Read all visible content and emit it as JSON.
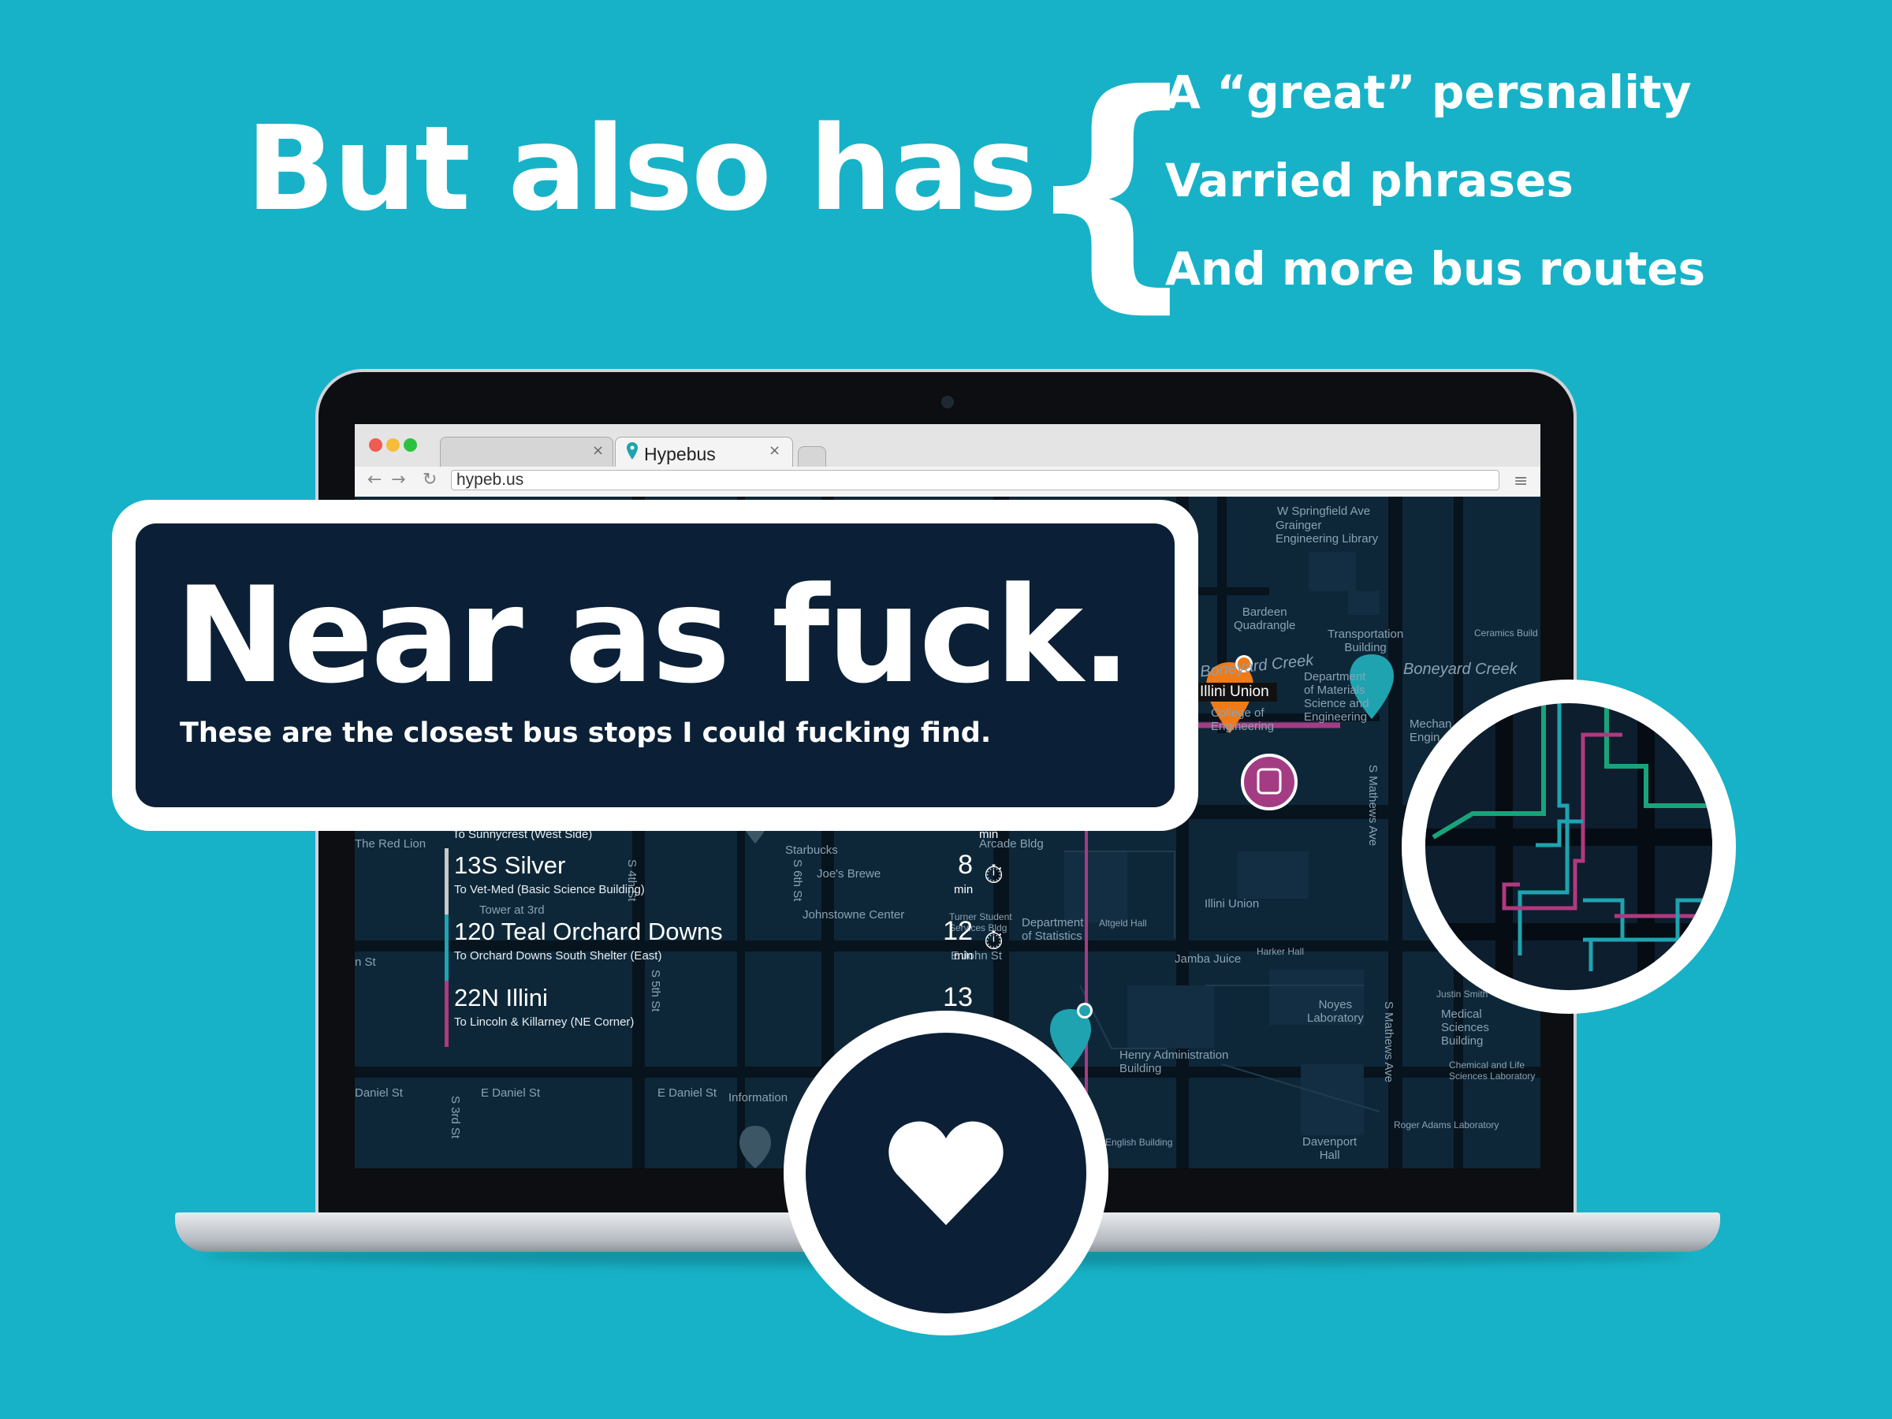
{
  "headline": "But also has",
  "brace": "{",
  "features": [
    "A “great” persnality",
    "Varried phrases",
    "And more bus routes"
  ],
  "browser": {
    "tab_title": "Hypebus",
    "tab_close": "×",
    "url": "hypeb.us"
  },
  "callout": {
    "title": "Near as fuck.",
    "subtitle": "These are the closest bus stops I could fucking find."
  },
  "bus_list": {
    "partial_row": {
      "sub": "To Sunnycrest (West Side)",
      "unit": "min"
    },
    "routes": [
      {
        "name": "13S Silver",
        "to": "To Vet-Med (Basic Science Building)",
        "eta": "8",
        "unit": "min",
        "color": "#c9c9c9"
      },
      {
        "name": "120 Teal Orchard Downs",
        "to": "To Orchard Downs South Shelter (East)",
        "eta": "12",
        "unit": "min",
        "color": "#1fa3b0"
      },
      {
        "name": "22N Illini",
        "to": "To Lincoln & Killarney (NE Corner)",
        "eta": "13",
        "unit": "",
        "color": "#b0397f"
      }
    ]
  },
  "map_labels": {
    "grainger": "Grainger\nEngineering Library",
    "bardeen": "Bardeen\nQuadrangle",
    "transportation": "Transportation\nBuilding",
    "ceramics": "Ceramics Build",
    "boneyard1": "Boneyard Creek",
    "boneyard2": "Boneyard Creek",
    "illini_union_tag": "Illini Union",
    "college_eng": "College of\nEngineering",
    "materials": "Department\nof Materials\nScience and\nEngineering",
    "mechanical": "Mechan\nEngin",
    "red_lion": "The Red Lion",
    "starbucks": "Starbucks",
    "joes": "Joe's Brewe",
    "tower": "Tower at 3rd",
    "johnstowne": "Johnstowne Center",
    "arcade": "Arcade Bldg",
    "turner": "Turner Student\nServices Bldg",
    "statistics": "Department\nof Statistics",
    "altgeld": "Altgeld Hall",
    "illini_union": "Illini Union",
    "jamba": "Jamba Juice",
    "harker": "Harker Hall",
    "e_john": "E John St",
    "noyes": "Noyes\nLaboratory",
    "justin": "Justin Smith",
    "medical": "Medical\nSciences\nBuilding",
    "chemical": "Chemical and Life\nSciences Laboratory",
    "henry": "Henry Administration\nBuilding",
    "english": "English Building",
    "davenport": "Davenport\nHall",
    "roger": "Roger Adams Laboratory",
    "information": "Information",
    "e_daniel": "E Daniel St",
    "e_daniel2": "E Daniel St",
    "daniel_st": "Daniel St",
    "springfield": "W Springfield Ave",
    "sixth": "S 6th St",
    "fourth": "S 4th St",
    "fifth": "S 5th St",
    "third": "S 3rd St",
    "mathews": "S Mathews Ave",
    "mathews2": "S Mathews Ave",
    "john": "n St"
  },
  "colors": {
    "background": "#17b2c7",
    "navy": "#0b2036",
    "teal_route": "#1fa3b0",
    "magenta_route": "#b0397f",
    "green_route": "#1aa37a",
    "orange_pin": "#f07a18"
  },
  "icons": {
    "favorite": "heart-icon",
    "timer": "stopwatch-icon",
    "bus_stop": "bus-stop-icon"
  }
}
